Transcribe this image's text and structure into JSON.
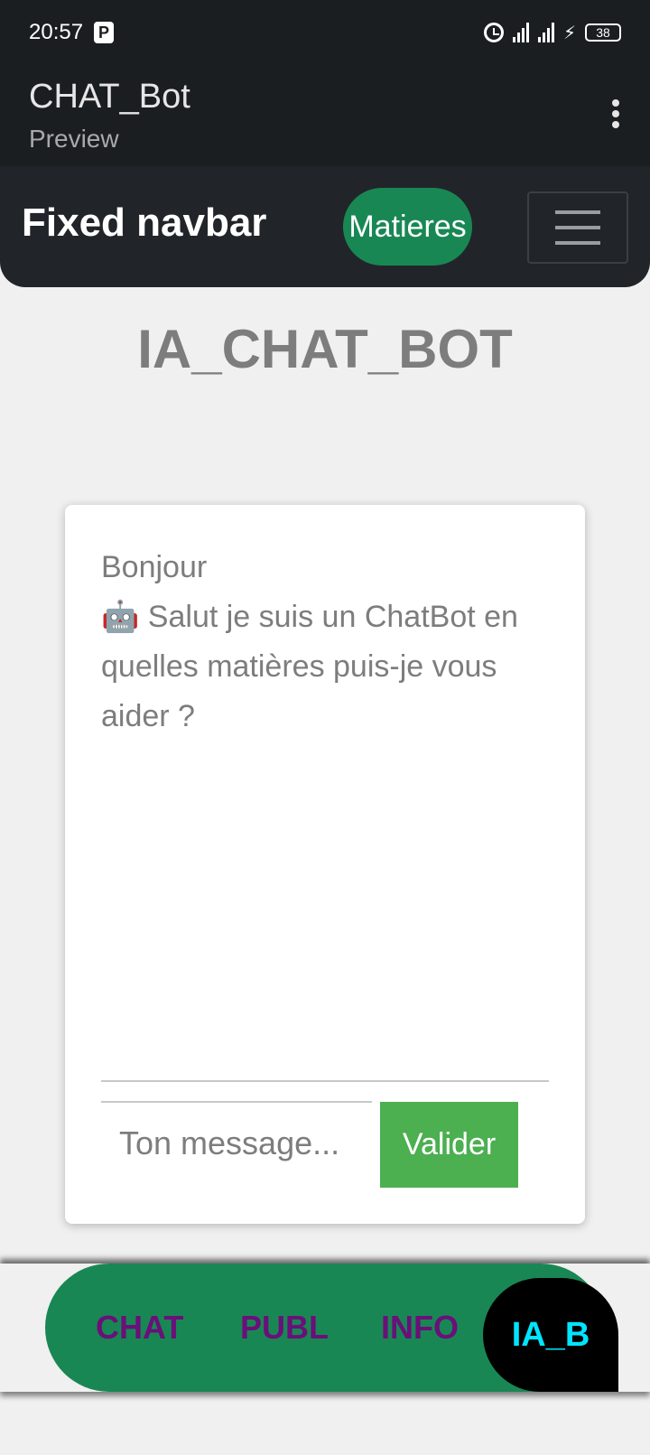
{
  "status_bar": {
    "time": "20:57",
    "p_badge": "P",
    "battery": "38",
    "icons": [
      "alarm-icon",
      "signal-icon",
      "signal-icon",
      "bolt-icon",
      "battery-icon"
    ]
  },
  "app_bar": {
    "title": "CHAT_Bot",
    "subtitle": "Preview",
    "menu_icon": "kebab-icon"
  },
  "navbar": {
    "brand": "Fixed navbar",
    "matieres_label": "Matieres",
    "toggler_icon": "hamburger-icon",
    "accent_color": "#198754"
  },
  "main": {
    "heading": "IA_CHAT_BOT"
  },
  "chat": {
    "greeting": "Bonjour",
    "bot_emoji": "🤖",
    "bot_message": "Salut je suis un ChatBot en quelles matières puis-je vous aider ?",
    "input_placeholder": "Ton message...",
    "submit_label": "Valider",
    "submit_color": "#4caf50"
  },
  "bottom_nav": {
    "items": [
      {
        "label": "CHAT"
      },
      {
        "label": "PUBL"
      },
      {
        "label": "INFO"
      },
      {
        "label": "IA_B",
        "active": true
      }
    ],
    "background_color": "#198754",
    "label_color": "#6b0f7a",
    "active_label_color": "#00e5ff"
  }
}
